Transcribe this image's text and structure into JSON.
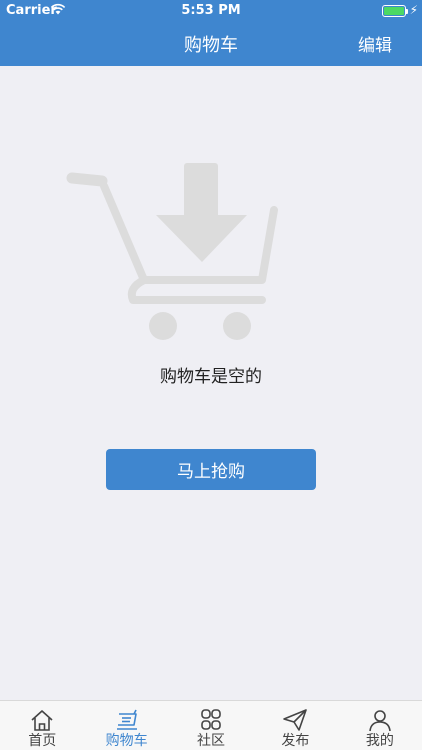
{
  "status_bar": {
    "carrier": "Carrier",
    "time": "5:53 PM"
  },
  "nav": {
    "title": "购物车",
    "edit_label": "编辑"
  },
  "empty_state": {
    "message": "购物车是空的",
    "button_label": "马上抢购"
  },
  "tabs": [
    {
      "label": "首页",
      "icon": "home-icon",
      "active": false
    },
    {
      "label": "购物车",
      "icon": "cart-icon",
      "active": true
    },
    {
      "label": "社区",
      "icon": "community-icon",
      "active": false
    },
    {
      "label": "发布",
      "icon": "publish-icon",
      "active": false
    },
    {
      "label": "我的",
      "icon": "profile-icon",
      "active": false
    }
  ],
  "colors": {
    "accent": "#3f86cf",
    "background": "#efeff4",
    "battery": "#4cd964",
    "illustration": "#dcdcdc"
  }
}
